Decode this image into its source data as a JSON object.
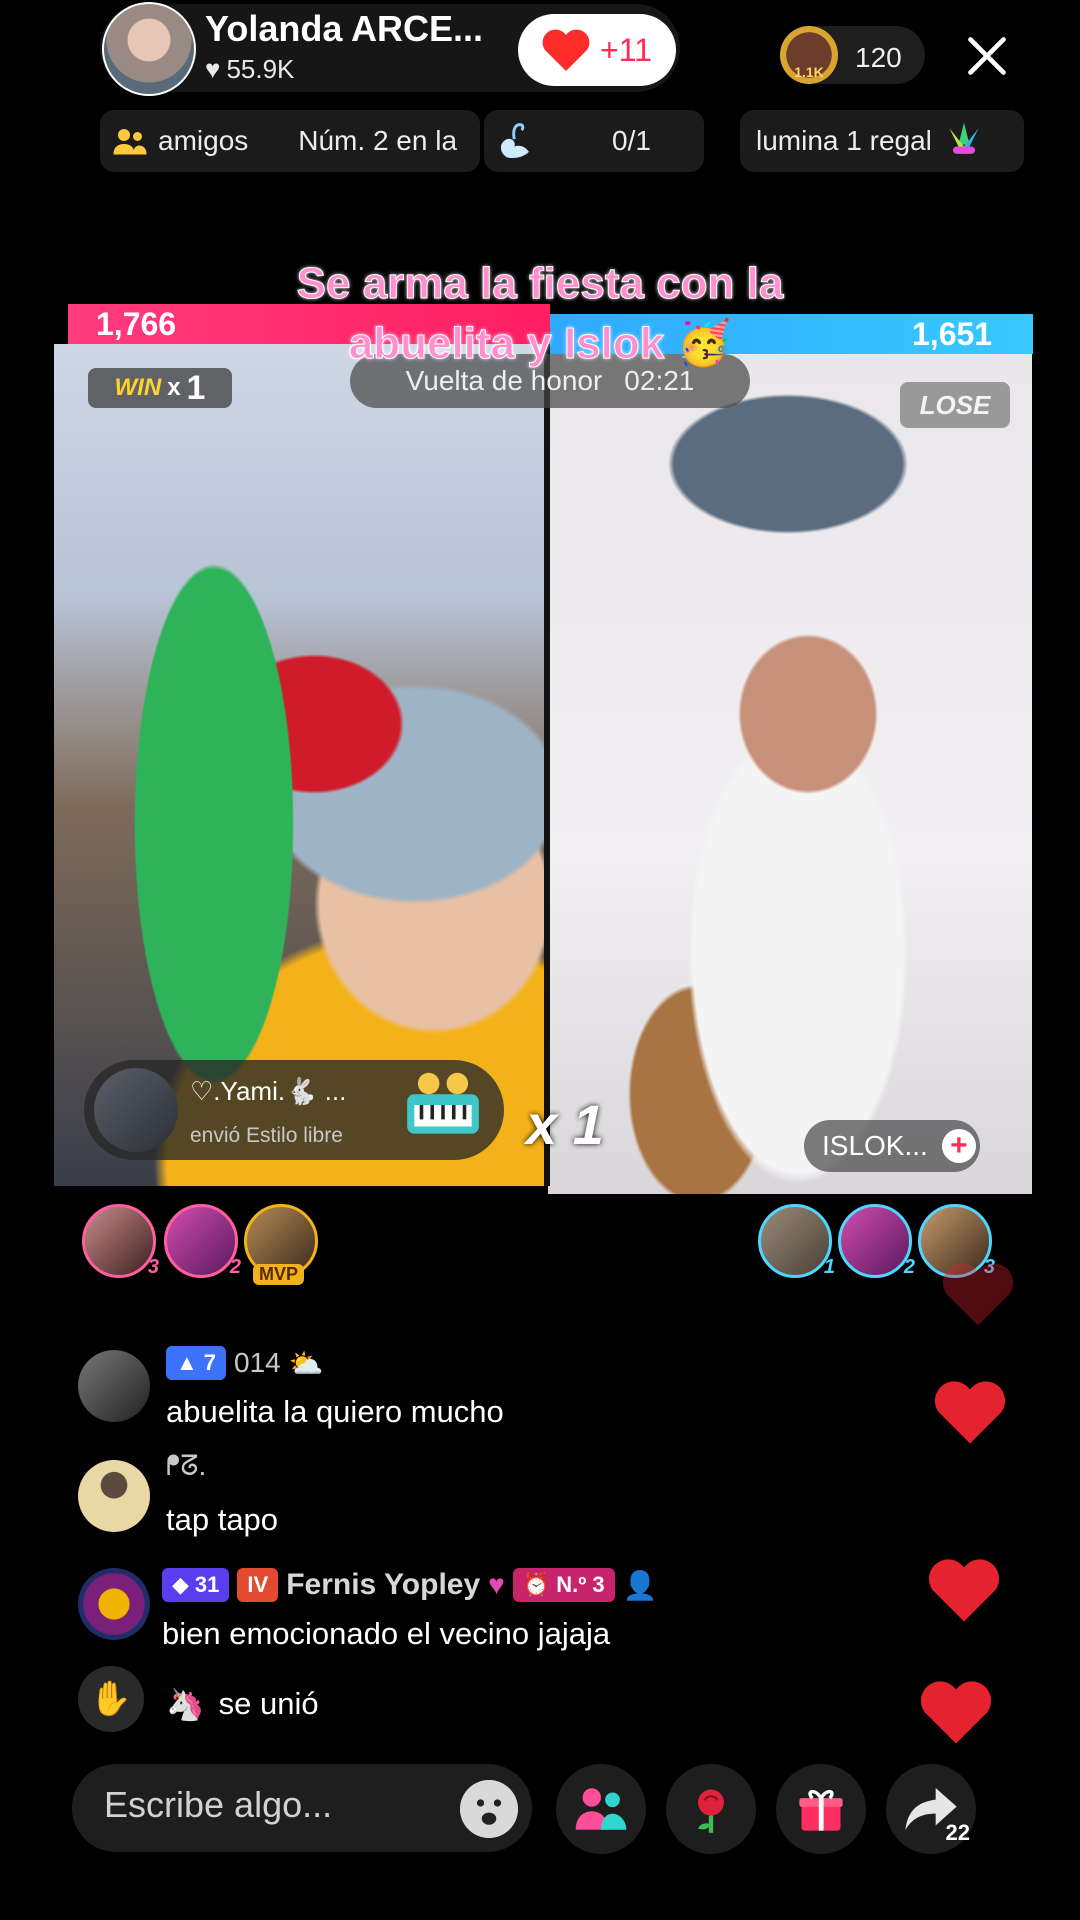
{
  "header": {
    "host_name": "Yolanda ARCE...",
    "likes": "55.9K",
    "follow_count": "+11",
    "coin_label": "1.1K",
    "viewer_count": "120"
  },
  "chips": {
    "friends": "amigos",
    "rank": "Núm. 2 en la",
    "goal_progress": "0/1",
    "gift_goal": "lumina 1 regal"
  },
  "battle": {
    "caption_line1": "Se arma la fiesta con la",
    "caption_line2": "abuelita y Islok",
    "left_score": "1,766",
    "right_score": "1,651",
    "win_label": "WIN",
    "win_multiplier": "x",
    "win_count": "1",
    "lose_label": "LOSE",
    "round_label": "Vuelta de honor",
    "timer": "02:21",
    "combo": "x 1",
    "opponent_name": "ISLOK...",
    "colors": {
      "left": "#ff1e62",
      "right": "#38c9ff"
    }
  },
  "gift_toast": {
    "user": "♡.Yami.🐇 ...",
    "action": "envió Estilo libre"
  },
  "rank_left": [
    {
      "badge": "3"
    },
    {
      "badge": "2"
    },
    {
      "badge": "MVP"
    }
  ],
  "rank_right": [
    {
      "badge": "1"
    },
    {
      "badge": "2"
    },
    {
      "badge": "3"
    }
  ],
  "chat": [
    {
      "level": "7",
      "name": "014",
      "message": "abuelita la quiero mucho"
    },
    {
      "name": "ᖰᘔ.",
      "message": "tap tapo"
    },
    {
      "level": "31",
      "fan_level": "IV",
      "name": "Fernis Yopley",
      "rank_badge": "N.º 3",
      "message": "bien emocionado el vecino jajaja"
    },
    {
      "message": "se unió"
    }
  ],
  "bottom": {
    "input_placeholder": "Escribe algo...",
    "share_count": "22"
  }
}
